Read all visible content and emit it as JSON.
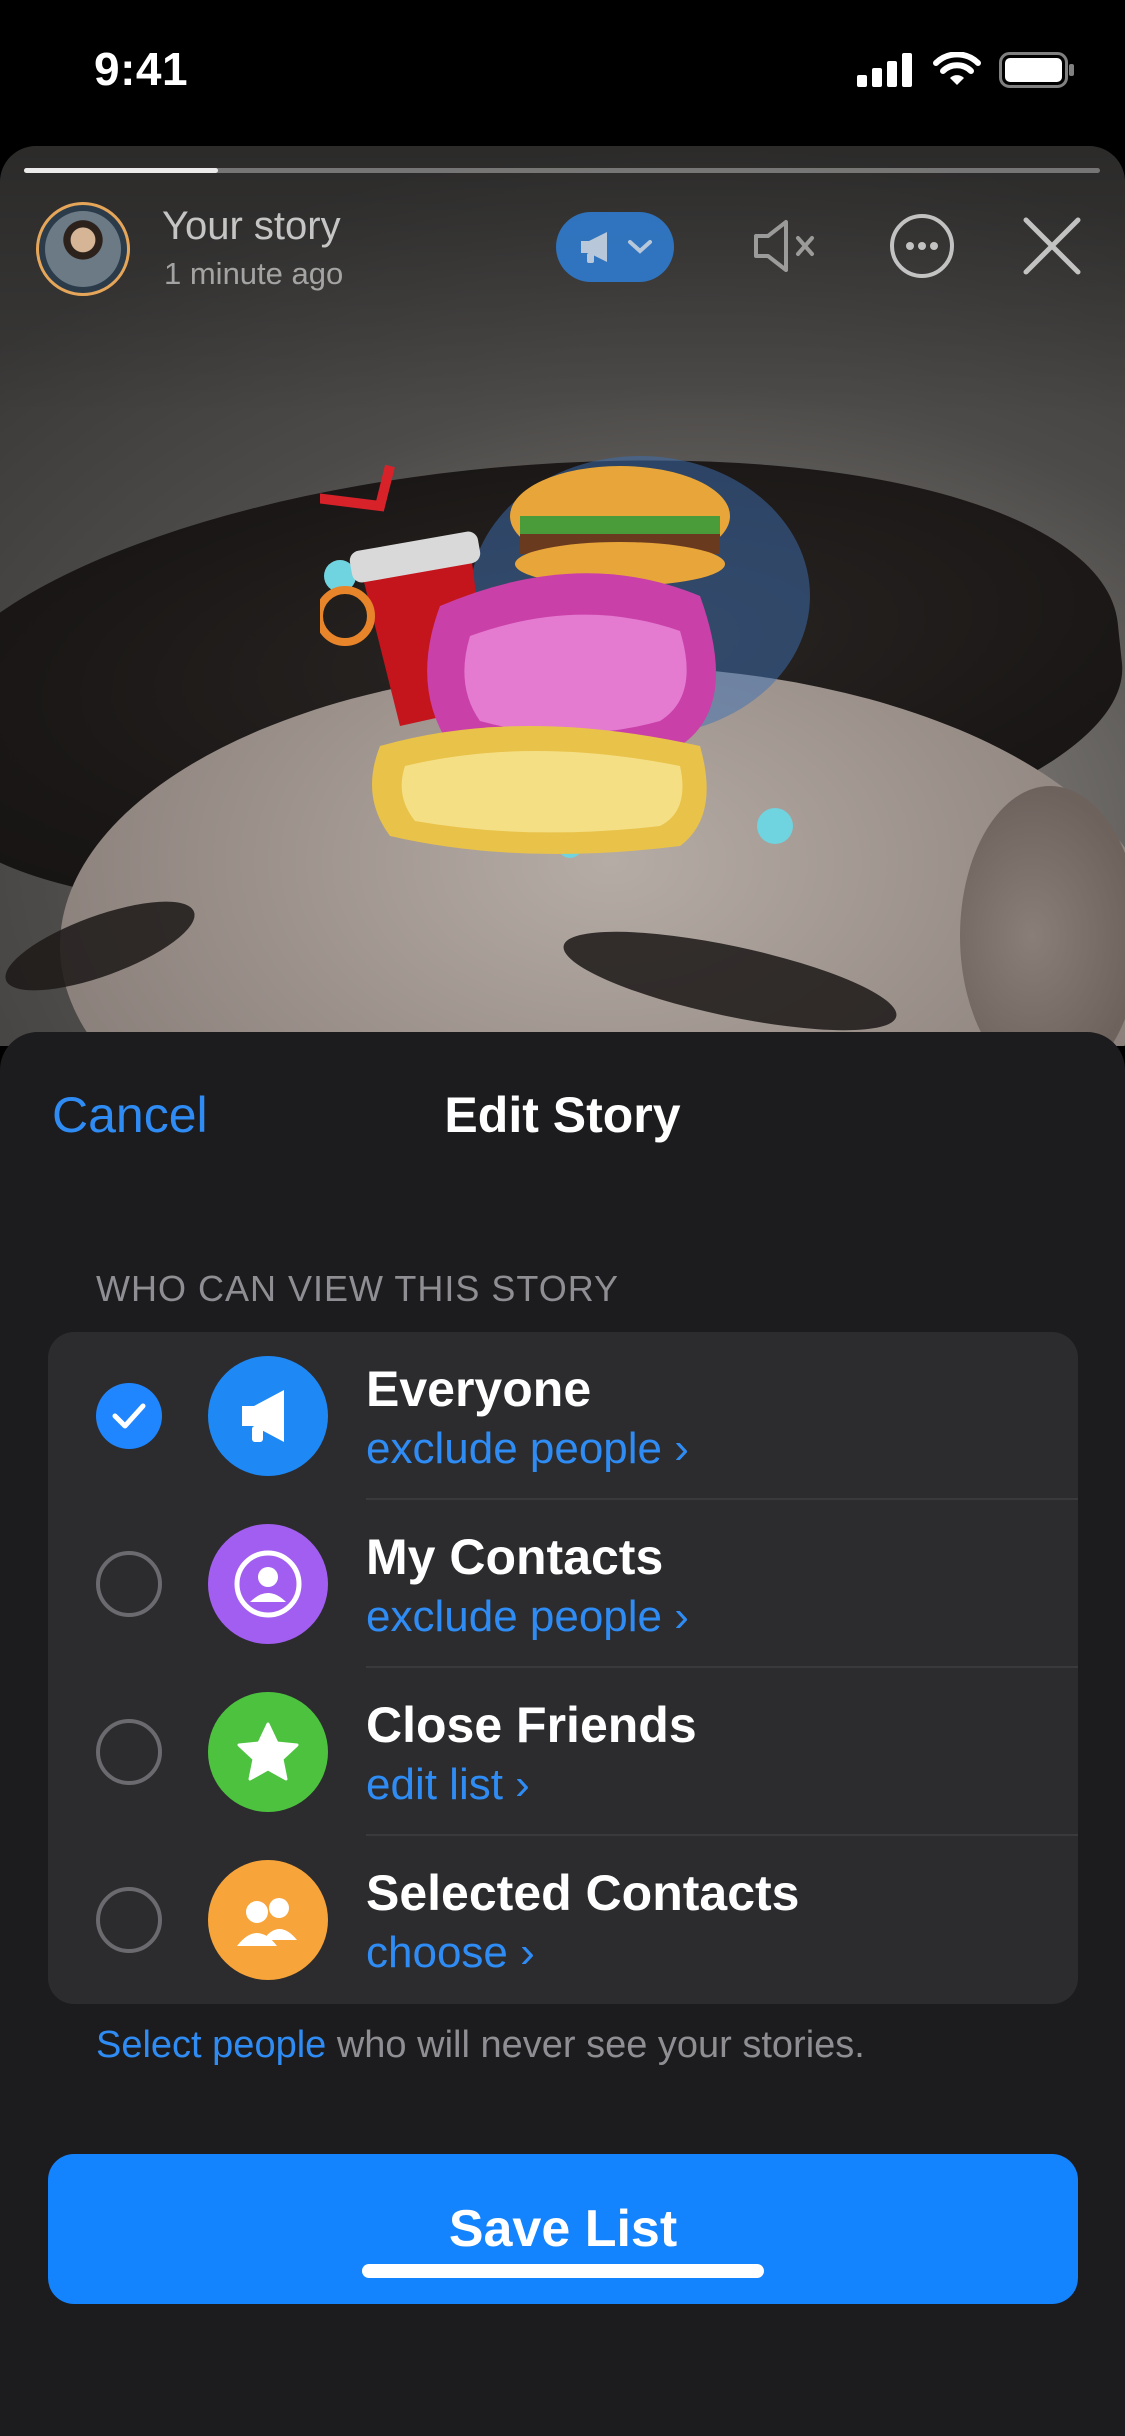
{
  "status_bar": {
    "time": "9:41"
  },
  "story": {
    "title": "Your story",
    "subtitle": "1 minute ago",
    "progress": 0.18
  },
  "sheet": {
    "cancel_label": "Cancel",
    "title": "Edit Story",
    "section_header": "WHO CAN VIEW THIS STORY",
    "options": [
      {
        "title": "Everyone",
        "action": "exclude people ›",
        "selected": true,
        "color": "#1e88f5",
        "icon": "megaphone-icon"
      },
      {
        "title": "My Contacts",
        "action": "exclude people ›",
        "selected": false,
        "color": "#a25ef0",
        "icon": "person-icon"
      },
      {
        "title": "Close Friends",
        "action": "edit list ›",
        "selected": false,
        "color": "#4cc23f",
        "icon": "star-icon"
      },
      {
        "title": "Selected Contacts",
        "action": "choose ›",
        "selected": false,
        "color": "#f7a43a",
        "icon": "people-icon"
      }
    ],
    "footer_link": "Select people",
    "footer_text": " who will never see your stories.",
    "save_label": "Save List"
  },
  "colors": {
    "accent": "#2f8cf4",
    "button": "#1383fe",
    "sheet_bg": "#1c1c1e",
    "group_bg": "#2c2c2e"
  }
}
